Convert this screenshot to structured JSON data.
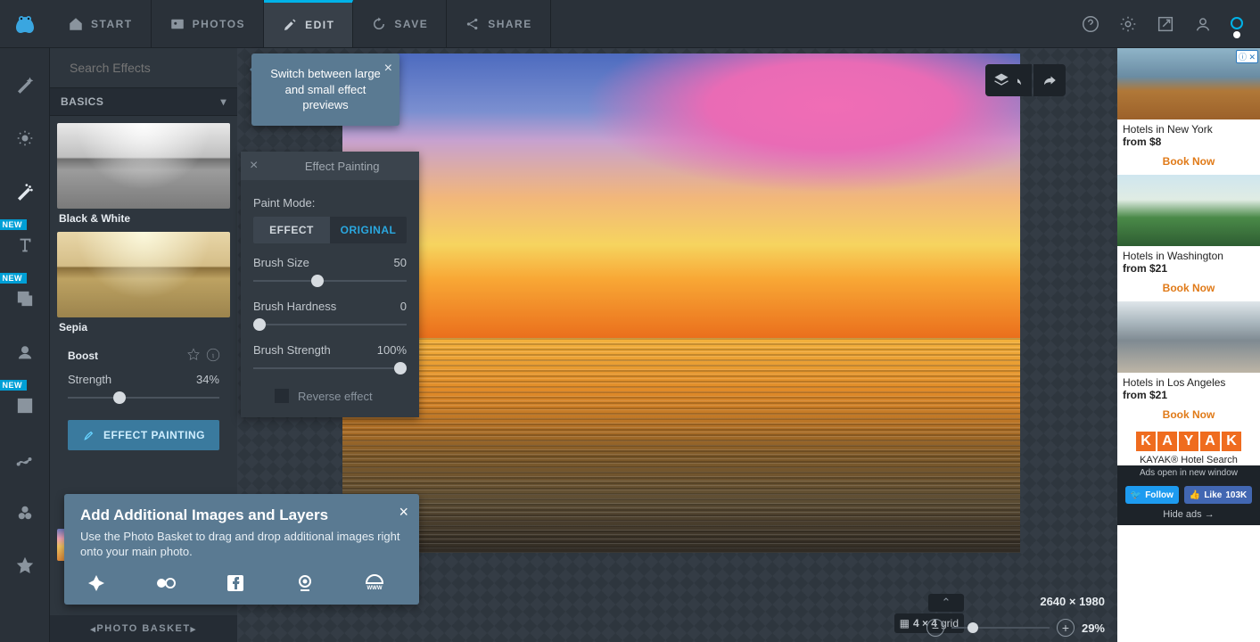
{
  "topnav": {
    "start": "START",
    "photos": "PHOTOS",
    "edit": "EDIT",
    "save": "SAVE",
    "share": "SHARE"
  },
  "search": {
    "placeholder": "Search Effects"
  },
  "accordion": {
    "basics": "BASICS"
  },
  "thumbs": {
    "bw": "Black & White",
    "sepia": "Sepia",
    "boost": "Boost"
  },
  "strength": {
    "label": "Strength",
    "value": "34%"
  },
  "effect_painting_btn": "EFFECT PAINTING",
  "tooltip_preview": "Switch between large and small effect previews",
  "ep": {
    "title": "Effect Painting",
    "paint_mode": "Paint Mode:",
    "effect": "EFFECT",
    "original": "ORIGINAL",
    "brush_size_l": "Brush Size",
    "brush_size_v": "50",
    "brush_hard_l": "Brush Hardness",
    "brush_hard_v": "0",
    "brush_str_l": "Brush Strength",
    "brush_str_v": "100%",
    "reverse": "Reverse effect"
  },
  "callout": {
    "title": "Add Additional Images and Layers",
    "body": "Use the Photo Basket to drag and drop additional images right onto your main photo."
  },
  "basket": "PHOTO BASKET",
  "badges": {
    "new": "NEW"
  },
  "status": {
    "dims": "2640 × 1980",
    "grid": "4 × 4",
    "grid_word": "grid",
    "zoom": "29%"
  },
  "ads": {
    "items": [
      {
        "title": "Hotels in New York",
        "price": "from $8",
        "cta": "Book Now"
      },
      {
        "title": "Hotels in Washington",
        "price": "from $21",
        "cta": "Book Now"
      },
      {
        "title": "Hotels in Los Angeles",
        "price": "from $21",
        "cta": "Book Now"
      }
    ],
    "kayak": "KAYAK® Hotel Search",
    "note": "Ads open in new window",
    "follow": "Follow",
    "like": "Like",
    "like_count": "103K",
    "hide": "Hide ads →"
  }
}
